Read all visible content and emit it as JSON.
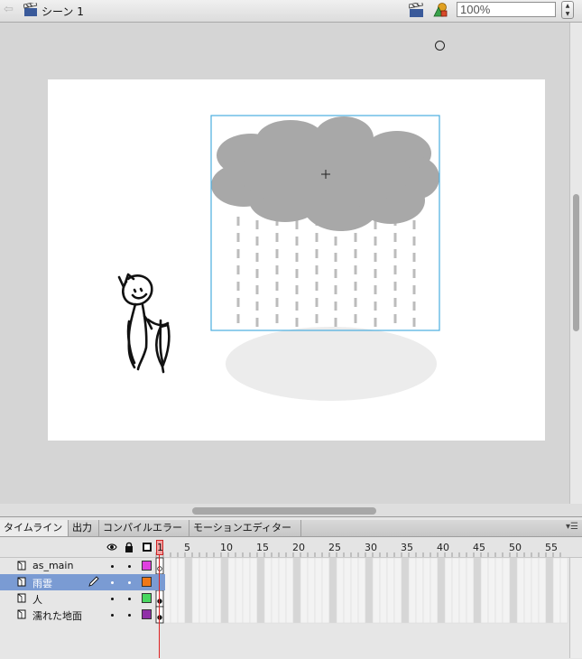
{
  "topbar": {
    "scene_label": "シーン 1",
    "zoom_value": "100%"
  },
  "icons": {
    "back": "left-arrow-icon",
    "scene": "clapperboard-icon",
    "edit_scene": "clapperboard-icon",
    "edit_symbol": "shapes-icon",
    "eye": "eye-icon",
    "lock": "lock-icon",
    "outline": "square-outline-icon",
    "pencil": "pencil-icon",
    "layer": "page-icon"
  },
  "timeline": {
    "tabs": [
      "タイムライン",
      "出力",
      "コンパイルエラー",
      "モーションエディター"
    ],
    "active_tab": 0,
    "frame_labels": [
      "1",
      "5",
      "10",
      "15",
      "20",
      "25",
      "30",
      "35",
      "40",
      "45",
      "50",
      "55"
    ],
    "current_frame": 1,
    "layers": [
      {
        "name": "as_main",
        "color": "#e040e0",
        "selected": false
      },
      {
        "name": "雨雲",
        "color": "#f07818",
        "selected": true
      },
      {
        "name": "人",
        "color": "#48d860",
        "selected": false
      },
      {
        "name": "濡れた地面",
        "color": "#9030a8",
        "selected": false
      }
    ]
  },
  "colors": {
    "selection_box": "#4aaee0",
    "cloud": "#a8a8a8",
    "rain": "#bcbcbc",
    "ground": "#ececec",
    "selected_layer": "#7a9bd3",
    "playhead": "#dd2222"
  }
}
